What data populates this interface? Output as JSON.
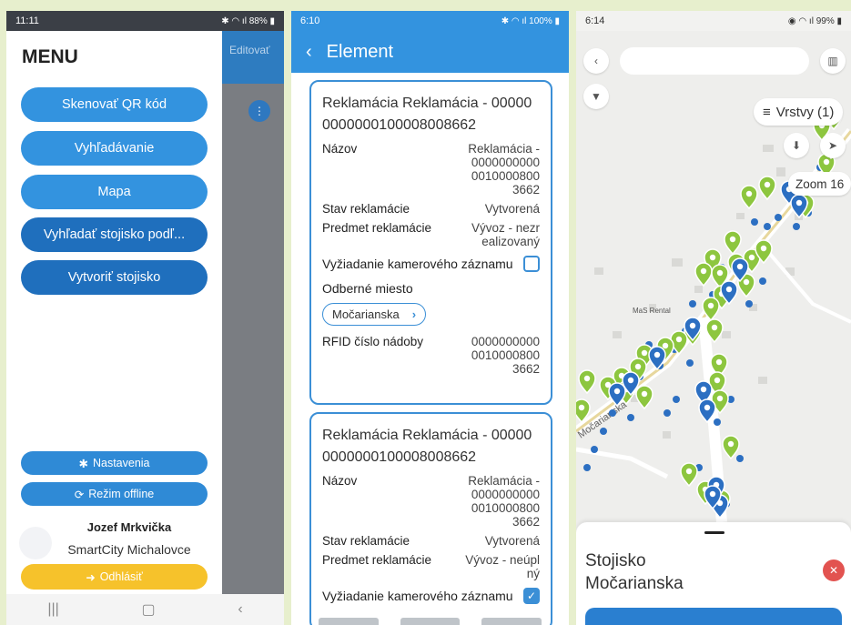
{
  "phone1": {
    "status_time": "11:11",
    "status_battery": "88%",
    "edit_label": "Editovať",
    "menu_title": "MENU",
    "menu_items": [
      {
        "label": "Skenovať QR kód"
      },
      {
        "label": "Vyhľadávanie"
      },
      {
        "label": "Mapa"
      },
      {
        "label": "Vyhľadať stojisko podľ..."
      },
      {
        "label": "Vytvoriť stojisko"
      }
    ],
    "settings_label": "Nastavenia",
    "offline_label": "Režim offline",
    "user_name": "Jozef Mrkvička",
    "user_org": "SmartCity Michalovce",
    "logout_label": "Odhlásiť"
  },
  "phone2": {
    "status_time": "6:10",
    "status_battery": "100%",
    "title": "Element",
    "cards": [
      {
        "title": "Reklamácia Reklamácia - 000000000000100008008662",
        "name_label": "Názov",
        "name_value": "Reklamácia - 000000000000100008003662",
        "state_label": "Stav reklamácie",
        "state_value": "Vytvorená",
        "subject_label": "Predmet reklamácie",
        "subject_value": "Vývoz - nezrealizovaný",
        "camera_label": "Vyžiadanie kamerového záznamu",
        "camera_checked": false,
        "place_label": "Odberné miesto",
        "place_value": "Močarianska",
        "rfid_label": "RFID číslo nádoby",
        "rfid_value": "000000000000100008003662"
      },
      {
        "title": "Reklamácia Reklamácia - 000000000000100008008662",
        "name_label": "Názov",
        "name_value": "Reklamácia - 000000000000100008003662",
        "state_label": "Stav reklamácie",
        "state_value": "Vytvorená",
        "subject_label": "Predmet reklamácie",
        "subject_value": "Vývoz - neúplný",
        "camera_label": "Vyžiadanie kamerového záznamu",
        "camera_checked": true
      }
    ]
  },
  "phone3": {
    "status_time": "6:14",
    "status_battery": "99%",
    "layers_label": "Vrstvy (1)",
    "zoom_label": "Zoom 16",
    "map_street": "Močarianska",
    "map_place": "MaS Rental",
    "sheet_title_line1": "Stojisko",
    "sheet_title_line2": "Močarianska",
    "colors": {
      "green_pin": "#8dc63f",
      "blue_pin": "#2c6fc2",
      "accent": "#3393df"
    }
  }
}
